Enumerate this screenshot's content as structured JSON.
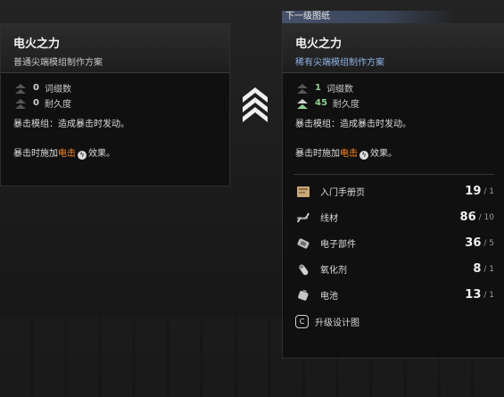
{
  "colors": {
    "rare_blue": "#8fb2e6",
    "stat_green": "#8fd08f",
    "shock_orange": "#ff8a2a",
    "tab_bg": "#46516a"
  },
  "current": {
    "title": "电火之力",
    "subtitle": "普通尖端模组制作方案",
    "stats": [
      {
        "value": "0",
        "label": "词缀数"
      },
      {
        "value": "0",
        "label": "耐久度"
      }
    ],
    "effect_line1": "暴击模组：造成暴击时发动。",
    "effect_prefix": "暴击时施加",
    "effect_keyword": "电击",
    "effect_suffix": "效果。"
  },
  "next": {
    "tab_label": "下一级图纸",
    "title": "电火之力",
    "subtitle": "稀有尖端模组制作方案",
    "stats": [
      {
        "value": "1",
        "label": "词缀数"
      },
      {
        "value": "45",
        "label": "耐久度"
      }
    ],
    "effect_line1": "暴击模组：造成暴击时发动。",
    "effect_prefix": "暴击时施加",
    "effect_keyword": "电击",
    "effect_suffix": "效果。",
    "materials": [
      {
        "icon": "manual-page-icon",
        "name": "入门手册页",
        "have": "19",
        "need": "/ 1"
      },
      {
        "icon": "wire-icon",
        "name": "线材",
        "have": "86",
        "need": "/ 10"
      },
      {
        "icon": "electronic-part-icon",
        "name": "电子部件",
        "have": "36",
        "need": "/ 5"
      },
      {
        "icon": "oxidizer-icon",
        "name": "氧化剂",
        "have": "8",
        "need": "/ 1"
      },
      {
        "icon": "battery-icon",
        "name": "电池",
        "have": "13",
        "need": "/ 1"
      }
    ],
    "upgrade_key": "C",
    "upgrade_label": "升级设计图"
  },
  "arrow_icon": "upgrade-chevron-icon"
}
